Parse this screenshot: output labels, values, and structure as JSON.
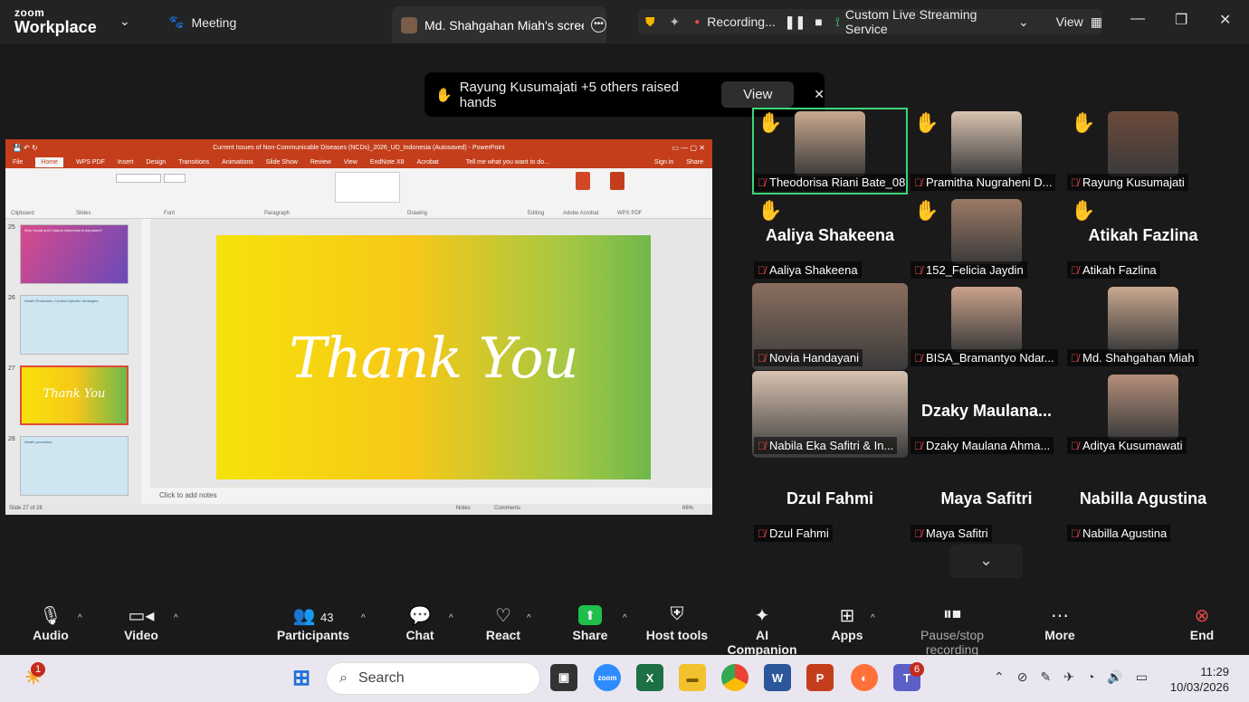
{
  "app": {
    "logo_top": "zoom",
    "logo_bottom": "Workplace",
    "meeting_label": "Meeting",
    "share_tab": "Md. Shahgahan Miah's screen"
  },
  "status": {
    "recording": "Recording...",
    "streaming": "Custom Live Streaming Service",
    "view": "View"
  },
  "banner": {
    "text": "Rayung Kusumajati +5 others raised hands",
    "view_button": "View"
  },
  "ppt": {
    "title": "Current Issues of Non-Communicable Diseases (NCDs)_2026_UD_Indonesia (Autosaved) - PowerPoint",
    "tabs": [
      "File",
      "Home",
      "WPS PDF",
      "Insert",
      "Design",
      "Transitions",
      "Animations",
      "Slide Show",
      "Review",
      "View",
      "EndNote X8",
      "Acrobat"
    ],
    "tell_me": "Tell me what you want to do...",
    "sign_in": "Sign in",
    "share": "Share",
    "groups": [
      "Clipboard",
      "Slides",
      "Font",
      "Paragraph",
      "Drawing",
      "Editing",
      "Adobe Acrobat",
      "WPS PDF"
    ],
    "thumbnails": [
      {
        "num": "25",
        "title": "Why Social and Cultural Influences is important?"
      },
      {
        "num": "26",
        "title": "Health Promotion: Context-Specific Strategies"
      },
      {
        "num": "27",
        "title": "Thank You"
      },
      {
        "num": "28",
        "title": "Health promotion"
      }
    ],
    "slide_text": "Thank You",
    "notes_placeholder": "Click to add notes",
    "status_left": "Slide 27 of 28",
    "status_notes": "Notes",
    "status_comments": "Comments",
    "zoom": "66%"
  },
  "participants_grid": [
    {
      "name": "Theodorisa Riani Bate_08...",
      "hand": true,
      "video": true,
      "active": true
    },
    {
      "name": "Pramitha Nugraheni D...",
      "hand": true,
      "video": true
    },
    {
      "name": "Rayung Kusumajati",
      "hand": true,
      "video": true
    },
    {
      "name": "Aaliya Shakeena",
      "big": "Aaliya Shakeena",
      "hand": true
    },
    {
      "name": "152_Felicia Jaydin",
      "hand": true,
      "video": true
    },
    {
      "name": "Atikah Fazlina",
      "big": "Atikah Fazlina",
      "hand": true
    },
    {
      "name": "Novia Handayani",
      "video": true
    },
    {
      "name": "BISA_Bramantyo Ndar...",
      "video": true
    },
    {
      "name": "Md. Shahgahan Miah",
      "video": true
    },
    {
      "name": "Nabila Eka Safitri & In...",
      "video": true
    },
    {
      "name": "Dzaky Maulana Ahma...",
      "big": "Dzaky  Maulana..."
    },
    {
      "name": "Aditya Kusumawati",
      "video": true
    },
    {
      "name": "Dzul Fahmi",
      "big": "Dzul Fahmi"
    },
    {
      "name": "Maya Safitri",
      "big": "Maya Safitri"
    },
    {
      "name": "Nabilla Agustina",
      "big": "Nabilla Agustina"
    }
  ],
  "toolbar": {
    "audio": "Audio",
    "video": "Video",
    "participants": "Participants",
    "participants_count": "43",
    "chat": "Chat",
    "react": "React",
    "share": "Share",
    "host_tools": "Host tools",
    "ai": "AI Companion",
    "apps": "Apps",
    "recording": "Pause/stop recording",
    "more": "More",
    "end": "End"
  },
  "taskbar": {
    "search": "Search",
    "weather_badge": "1",
    "teams_badge": "6",
    "time": "11:29",
    "date": "10/03/2026"
  },
  "colors": {
    "accent_green": "#3ed67a",
    "ppt_red": "#c43e1c",
    "share_green": "#1fbf4b",
    "end_red": "#e5484d"
  }
}
